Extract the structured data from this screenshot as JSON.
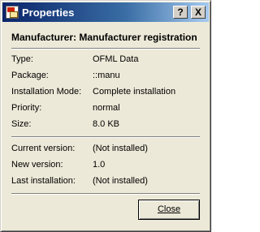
{
  "window": {
    "title": "Properties"
  },
  "titlebar": {
    "help_label": "?",
    "close_label": "X"
  },
  "heading": "Manufacturer: Manufacturer registration",
  "details": [
    {
      "label": "Type:",
      "value": "OFML Data"
    },
    {
      "label": "Package:",
      "value": "::manu"
    },
    {
      "label": "Installation Mode:",
      "value": "Complete installation"
    },
    {
      "label": "Priority:",
      "value": "normal"
    },
    {
      "label": "Size:",
      "value": "8.0 KB"
    }
  ],
  "versions": [
    {
      "label": "Current version:",
      "value": "(Not installed)"
    },
    {
      "label": "New version:",
      "value": "1.0"
    },
    {
      "label": "Last installation:",
      "value": "(Not installed)"
    }
  ],
  "buttons": {
    "close_label": "Close"
  },
  "colors": {
    "titlebar_start": "#0a246a",
    "titlebar_end": "#a6caf0",
    "dialog_bg": "#ece9d8"
  }
}
